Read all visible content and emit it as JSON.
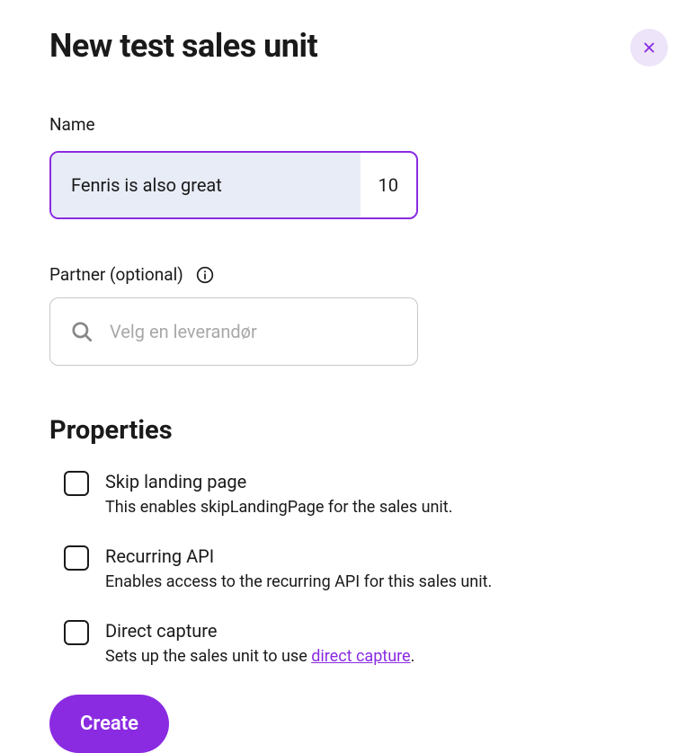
{
  "header": {
    "title": "New test sales unit"
  },
  "fields": {
    "name": {
      "label": "Name",
      "value": "Fenris is also great",
      "counter": "10"
    },
    "partner": {
      "label": "Partner (optional)",
      "placeholder": "Velg en leverandør"
    }
  },
  "properties": {
    "title": "Properties",
    "items": [
      {
        "title": "Skip landing page",
        "description": "This enables skipLandingPage for the sales unit."
      },
      {
        "title": "Recurring API",
        "description": "Enables access to the recurring API for this sales unit."
      },
      {
        "title": "Direct capture",
        "description_before": "Sets up the sales unit to use ",
        "link_text": "direct capture",
        "description_after": "."
      }
    ]
  },
  "buttons": {
    "create": "Create"
  }
}
